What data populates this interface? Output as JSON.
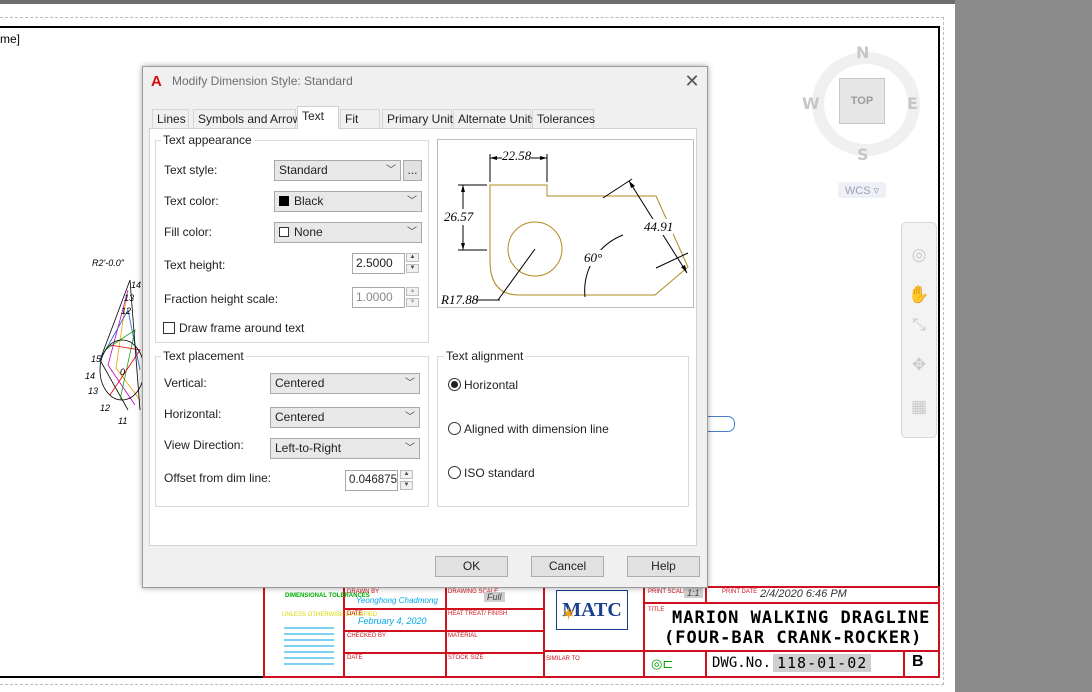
{
  "viewport": {
    "label": "me]"
  },
  "viewcube": {
    "north": "N",
    "south": "S",
    "east": "E",
    "west": "W",
    "face": "TOP",
    "ucs": "WCS ▿"
  },
  "drawing": {
    "labels": [
      "R2'-0.0\"",
      "14",
      "13",
      "12",
      "15",
      "14",
      "13",
      "12",
      "11",
      "0"
    ]
  },
  "title_block": {
    "tolerances_title": "DIMENSIONAL TOLERANCES",
    "tolerances_sub": "UNLESS OTHERWISE SPECIFIED",
    "drawn_by_label": "DRAWN BY",
    "drawn_by": "Yeonghong Chadmong",
    "date_label": "DATE",
    "date": "February 4, 2020",
    "checked_label": "CHECKED BY",
    "date2_label": "DATE",
    "scale_label": "DRAWING SCALE",
    "scale": "Full",
    "heat_label": "HEAT TREAT/ FINISH",
    "material_label": "MATERIAL",
    "stock_label": "STOCK SIZE",
    "logo": "MATC",
    "print_scale_label": "PRINT SCALE",
    "print_scale": "1:1",
    "print_date_label": "PRINT DATE",
    "print_date": "2/4/2020 6:46 PM",
    "title_label": "TITLE",
    "title_line1": "MARION WALKING DRAGLINE",
    "title_line2": "(FOUR-BAR CRANK-ROCKER)",
    "similar_label": "SIMILAR TO",
    "dwg_label": "DWG.No.",
    "dwg_no": "118-01-02",
    "rev": "B"
  },
  "dialog": {
    "app_icon": "A",
    "title": "Modify Dimension Style: Standard",
    "close": "✕",
    "tabs": [
      {
        "label": "Lines"
      },
      {
        "label": "Symbols and Arrows"
      },
      {
        "label": "Text"
      },
      {
        "label": "Fit"
      },
      {
        "label": "Primary Units"
      },
      {
        "label": "Alternate Units"
      },
      {
        "label": "Tolerances"
      }
    ],
    "active_tab": "Text",
    "text_appearance": {
      "title": "Text appearance",
      "style_label": "Text style:",
      "style_value": "Standard",
      "style_browse": "...",
      "color_label": "Text color:",
      "color_value": "Black",
      "fill_label": "Fill color:",
      "fill_value": "None",
      "height_label": "Text height:",
      "height_value": "2.5000",
      "fraction_label": "Fraction height scale:",
      "fraction_value": "1.0000",
      "frame_label": "Draw frame around text",
      "frame_checked": false
    },
    "text_placement": {
      "title": "Text placement",
      "vertical_label": "Vertical:",
      "vertical_value": "Centered",
      "horizontal_label": "Horizontal:",
      "horizontal_value": "Centered",
      "view_label": "View Direction:",
      "view_value": "Left-to-Right",
      "offset_label": "Offset from dim line:",
      "offset_value": "0.046875"
    },
    "text_alignment": {
      "title": "Text alignment",
      "options": [
        {
          "label": "Horizontal",
          "selected": true
        },
        {
          "label": "Aligned with dimension line",
          "selected": false
        },
        {
          "label": "ISO standard",
          "selected": false
        }
      ]
    },
    "preview": {
      "dim_top": "22.58",
      "dim_left": "26.57",
      "dim_right": "44.91",
      "dim_angle": "60°",
      "dim_radius": "R17.88"
    },
    "buttons": {
      "ok": "OK",
      "cancel": "Cancel",
      "help": "Help"
    }
  },
  "colors": {
    "title_block_red": "#d0101c",
    "preview_outline": "#b08a1e",
    "autocad_red": "#d01010"
  }
}
